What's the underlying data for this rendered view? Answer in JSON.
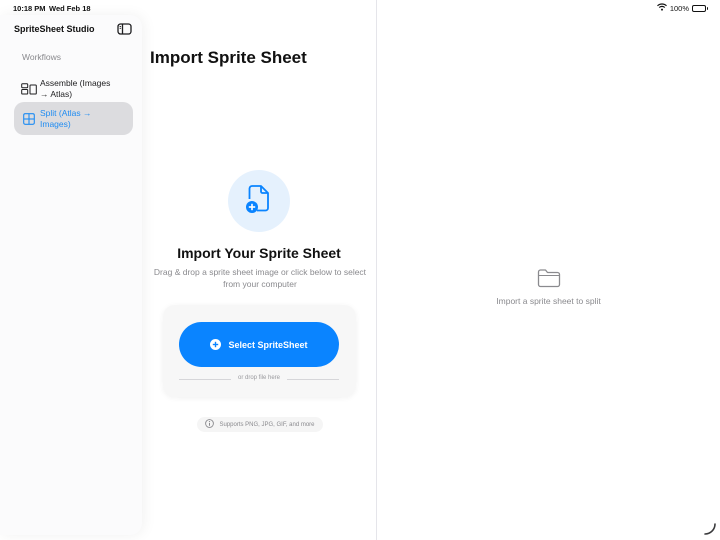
{
  "status_bar": {
    "time": "10:18 PM",
    "date": "Wed Feb 18",
    "battery": "100%"
  },
  "sidebar": {
    "app_title": "SpriteSheet Studio",
    "section_label": "Workflows",
    "items": [
      {
        "label": "Assemble (Images → Atlas)",
        "icon": "assemble-icon",
        "selected": false
      },
      {
        "label": "Split (Atlas → Images)",
        "icon": "grid-icon",
        "selected": true
      }
    ]
  },
  "main": {
    "title": "Import Sprite Sheet",
    "import_heading": "Import Your Sprite Sheet",
    "import_description": "Drag & drop a sprite sheet image or click below to select from your computer",
    "select_button_label": "Select SpriteSheet",
    "drop_hint": "or drop file here",
    "supports_text": "Supports PNG, JPG, GIF, and more"
  },
  "detail": {
    "empty_label": "Import a sprite sheet to split"
  },
  "colors": {
    "accent": "#0a84ff",
    "selected_bg": "#dcdcdf",
    "icon_bg": "#e5f1fd"
  }
}
